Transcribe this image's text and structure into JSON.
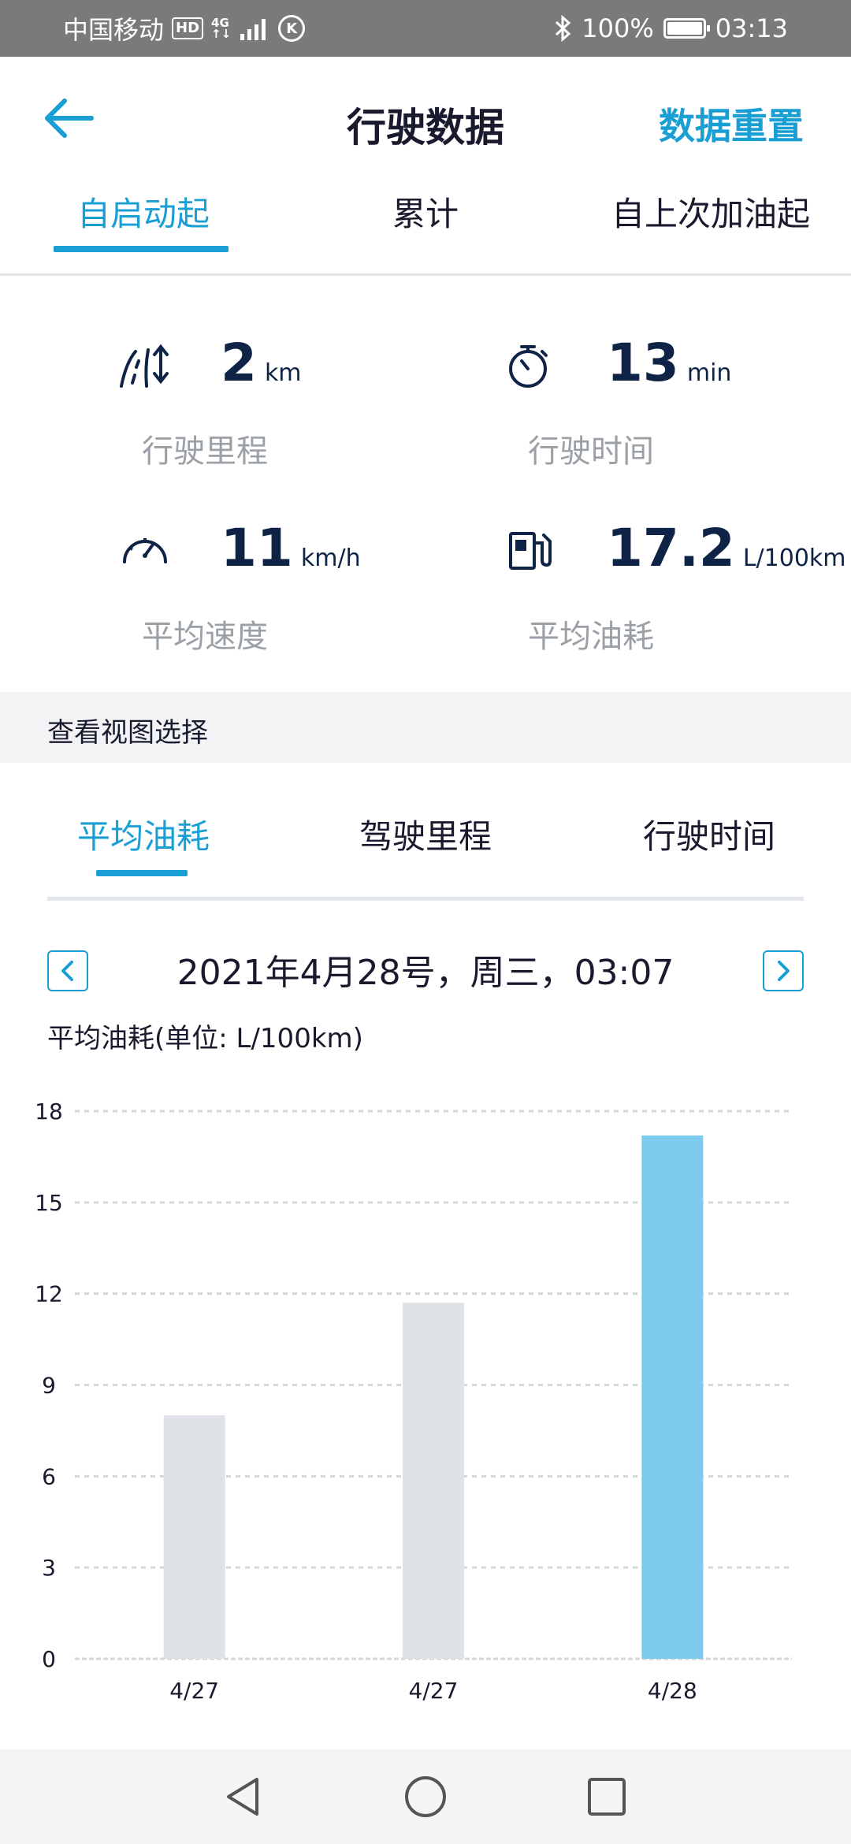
{
  "status_bar": {
    "carrier": "中国移动",
    "hd_badge": "HD",
    "network_top": "4G",
    "network_bottom": "↑↓",
    "k_badge": "K",
    "battery_text": "100%",
    "time": "03:13"
  },
  "header": {
    "title": "行驶数据",
    "reset_label": "数据重置"
  },
  "top_tabs": [
    {
      "label": "自启动起",
      "active": true
    },
    {
      "label": "累计",
      "active": false
    },
    {
      "label": "自上次加油起",
      "active": false
    }
  ],
  "stats": {
    "distance": {
      "value": "2",
      "unit": "km",
      "label": "行驶里程"
    },
    "duration": {
      "value": "13",
      "unit": "min",
      "label": "行驶时间"
    },
    "avg_speed": {
      "value": "11",
      "unit": "km/h",
      "label": "平均速度"
    },
    "avg_fuel": {
      "value": "17.2",
      "unit": "L/100km",
      "label": "平均油耗"
    }
  },
  "view_select": {
    "label": "查看视图选择"
  },
  "chart_tabs": [
    {
      "label": "平均油耗",
      "active": true
    },
    {
      "label": "驾驶里程",
      "active": false
    },
    {
      "label": "行驶时间",
      "active": false
    }
  ],
  "date_nav": {
    "date_text": "2021年4月28号，周三，03:07"
  },
  "unit_label": "平均油耗(单位: L/100km)",
  "colors": {
    "accent": "#1a9fd4",
    "bar_highlight": "#7ccbee",
    "bar_default": "#dfe3e8",
    "grid": "#d3d6da"
  },
  "chart_data": {
    "type": "bar",
    "categories": [
      "4/27",
      "4/27",
      "4/28"
    ],
    "values": [
      8.0,
      11.7,
      17.2
    ],
    "highlighted_index": 2,
    "title": "",
    "xlabel": "",
    "ylabel": "",
    "ylim": [
      0,
      18
    ],
    "yticks": [
      0,
      3,
      6,
      9,
      12,
      15,
      18
    ],
    "grid": true
  }
}
